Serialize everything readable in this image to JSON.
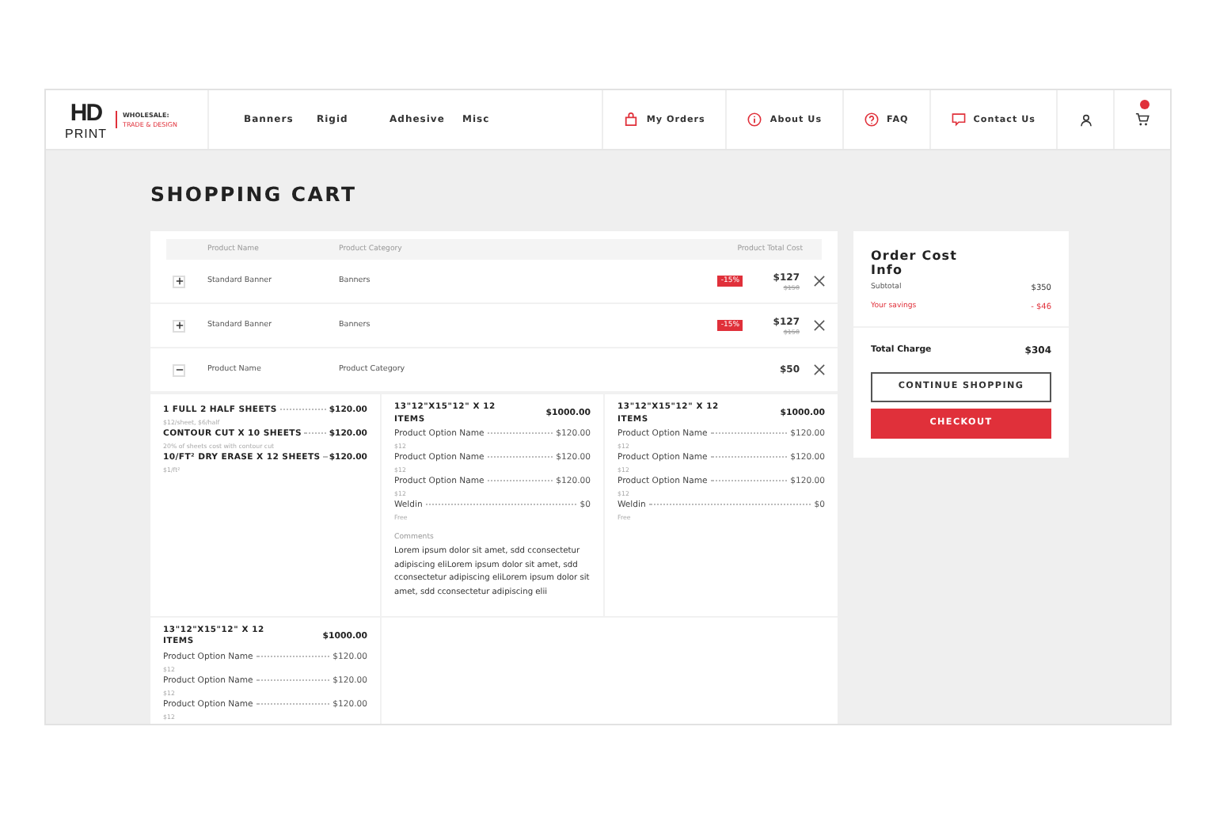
{
  "brand": {
    "logo": "HD",
    "logo_sub": "PRINT",
    "tag1": "WHOLESALE:",
    "tag2": "TRADE & DESIGN"
  },
  "nav": [
    "Banners",
    "Rigid",
    "Adhesive",
    "Misc"
  ],
  "links": [
    {
      "kind": "bag",
      "label": "My Orders"
    },
    {
      "kind": "info",
      "label": "About Us"
    },
    {
      "kind": "help",
      "label": "FAQ"
    },
    {
      "kind": "chat",
      "label": "Contact Us"
    }
  ],
  "title": "SHOPPING CART",
  "cart": {
    "columns": [
      "Product Name",
      "Product Category",
      "Product Total Cost"
    ],
    "items": [
      {
        "name": "Standard Banner",
        "category": "Banners",
        "discount": "-15%",
        "price": "$127",
        "old_price": "$150",
        "expanded": false
      },
      {
        "name": "Standard Banner",
        "category": "Banners",
        "discount": "-15%",
        "price": "$127",
        "old_price": "$150",
        "expanded": false
      },
      {
        "name": "Product Name",
        "category": "Product Category",
        "price": "$50",
        "expanded": true
      }
    ],
    "details": [
      {
        "kind": "sheets",
        "lines": [
          {
            "name": "1 FULL 2 HALF SHEETS",
            "price": "$120.00",
            "note": "$12/sheet, $6/half"
          },
          {
            "name": "CONTOUR CUT  X 10 SHEETS",
            "price": "$120.00",
            "note": "20% of sheets cost with contour cut"
          },
          {
            "name": "10/FT² DRY ERASE X 12 SHEETS",
            "price": "$120.00",
            "note": "$1/ft²"
          }
        ]
      },
      {
        "kind": "options",
        "title": "13\"12\"X15\"12\" X 12 ITEMS",
        "price": "$1000.00",
        "lines": [
          {
            "name": "Product Option Name",
            "price": "$120.00",
            "note": "$12"
          },
          {
            "name": "Product Option Name",
            "price": "$120.00",
            "note": "$12"
          },
          {
            "name": "Product Option Name",
            "price": "$120.00",
            "note": "$12"
          },
          {
            "name": "Weldin",
            "price": "$0",
            "note": "Free"
          }
        ],
        "comments_label": "Comments",
        "comments": "Lorem ipsum dolor sit amet,  sdd cconsectetur adipiscing eliLorem ipsum dolor sit amet,  sdd cconsectetur adipiscing eliLorem ipsum dolor sit amet,  sdd cconsectetur adipiscing elii"
      },
      {
        "kind": "options",
        "title": "13\"12\"X15\"12\" X 12 ITEMS",
        "price": "$1000.00",
        "lines": [
          {
            "name": "Product Option Name",
            "price": "$120.00",
            "note": "$12"
          },
          {
            "name": "Product Option Name",
            "price": "$120.00",
            "note": "$12"
          },
          {
            "name": "Product Option Name",
            "price": "$120.00",
            "note": "$12"
          },
          {
            "name": "Weldin",
            "price": "$0",
            "note": "Free"
          }
        ]
      },
      {
        "kind": "options",
        "title": "13\"12\"X15\"12\" X 12 ITEMS",
        "price": "$1000.00",
        "lines": [
          {
            "name": "Product Option Name",
            "price": "$120.00",
            "note": "$12"
          },
          {
            "name": "Product Option Name",
            "price": "$120.00",
            "note": "$12"
          },
          {
            "name": "Product Option Name",
            "price": "$120.00",
            "note": "$12"
          }
        ]
      }
    ]
  },
  "summary": {
    "title": "Order Cost Info",
    "subtotal_label": "Subtotal",
    "subtotal": "$350",
    "savings_label": "Your savings",
    "savings": "- $46",
    "total_label": "Total Charge",
    "total": "$304",
    "buttons": [
      {
        "kind": "outline",
        "label": "CONTINUE SHOPPING"
      },
      {
        "kind": "primary",
        "label": "CHECKOUT"
      }
    ]
  }
}
